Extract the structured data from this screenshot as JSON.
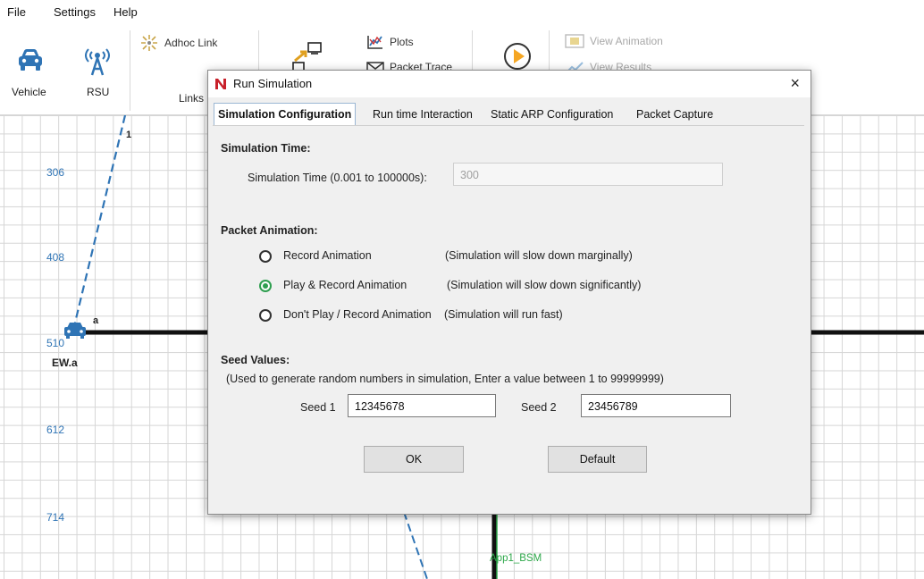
{
  "menu": [
    "File",
    "Settings",
    "Help"
  ],
  "ribbon": {
    "vehicle_label": "Vehicle",
    "rsu_label": "RSU",
    "adhoc_link_label": "Adhoc Link",
    "links_label": "Links",
    "plots_label": "Plots",
    "packet_trace_label": "Packet Trace",
    "view_animation_label": "View Animation",
    "view_results_label": "View Results"
  },
  "canvas": {
    "y_ticks": [
      "306",
      "408",
      "510",
      "612",
      "714"
    ],
    "node_label": "EW.a",
    "node_marker": "a",
    "link_label": "1",
    "app_label": "App1_BSM"
  },
  "dialog": {
    "title": "Run Simulation",
    "close": "×",
    "tabs": [
      "Simulation Configuration",
      "Run time Interaction",
      "Static ARP Configuration",
      "Packet Capture"
    ],
    "sim_time": {
      "heading": "Simulation Time:",
      "label": "Simulation Time (0.001 to 100000s):",
      "value": "300"
    },
    "packet_animation": {
      "heading": "Packet Animation:",
      "options": [
        {
          "label": "Record Animation",
          "note": "(Simulation will slow down marginally)"
        },
        {
          "label": "Play & Record Animation",
          "note": "(Simulation will slow down significantly)"
        },
        {
          "label": "Don't Play / Record Animation",
          "note": "(Simulation will run fast)"
        }
      ],
      "selected_index": 1
    },
    "seed": {
      "heading": "Seed Values:",
      "hint": "(Used to generate random numbers in simulation, Enter a value between 1 to 99999999)",
      "seed1_label": "Seed 1",
      "seed1_value": "12345678",
      "seed2_label": "Seed 2",
      "seed2_value": "23456789"
    },
    "ok_label": "OK",
    "default_label": "Default"
  },
  "colors": {
    "accent_blue": "#2f74b5",
    "radio_green": "#2e9e4f",
    "app_green": "#2ea84a"
  }
}
